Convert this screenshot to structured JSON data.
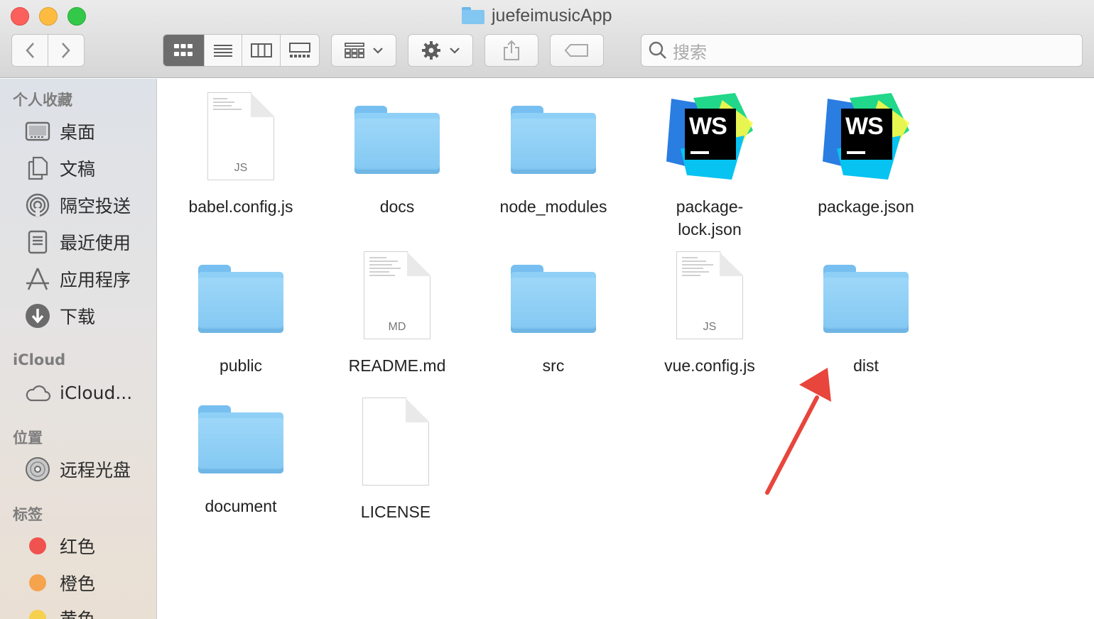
{
  "window": {
    "title": "juefeimusicApp"
  },
  "toolbar": {
    "search_placeholder": "搜索"
  },
  "sidebar": {
    "favorites_header": "个人收藏",
    "favorites": [
      {
        "label": "桌面",
        "icon": "desktop-icon"
      },
      {
        "label": "文稿",
        "icon": "documents-icon"
      },
      {
        "label": "隔空投送",
        "icon": "airdrop-icon"
      },
      {
        "label": "最近使用",
        "icon": "recents-icon"
      },
      {
        "label": "应用程序",
        "icon": "applications-icon"
      },
      {
        "label": "下载",
        "icon": "downloads-icon"
      }
    ],
    "icloud_header": "iCloud",
    "icloud": [
      {
        "label": "iCloud...",
        "icon": "cloud-icon"
      }
    ],
    "locations_header": "位置",
    "locations": [
      {
        "label": "远程光盘",
        "icon": "disc-icon"
      }
    ],
    "tags_header": "标签",
    "tags": [
      {
        "label": "红色",
        "color": "#f0524f"
      },
      {
        "label": "橙色",
        "color": "#f5a34d"
      },
      {
        "label": "黄色",
        "color": "#f6d14e"
      }
    ]
  },
  "files": [
    {
      "name": "babel.config.js",
      "kind": "js"
    },
    {
      "name": "docs",
      "kind": "folder"
    },
    {
      "name": "node_modules",
      "kind": "folder"
    },
    {
      "name": "package-\nlock.json",
      "kind": "ws"
    },
    {
      "name": "package.json",
      "kind": "ws"
    },
    {
      "name": "public",
      "kind": "folder"
    },
    {
      "name": "README.md",
      "kind": "md"
    },
    {
      "name": "src",
      "kind": "folder"
    },
    {
      "name": "vue.config.js",
      "kind": "js"
    },
    {
      "name": "dist",
      "kind": "folder"
    },
    {
      "name": "document",
      "kind": "folder"
    },
    {
      "name": "LICENSE",
      "kind": "blank"
    }
  ],
  "file_ext_labels": {
    "js": "JS",
    "md": "MD"
  },
  "ws_badge": "WS",
  "colors": {
    "annotation_arrow": "#e8453c",
    "folder": "#8fd0f7"
  }
}
